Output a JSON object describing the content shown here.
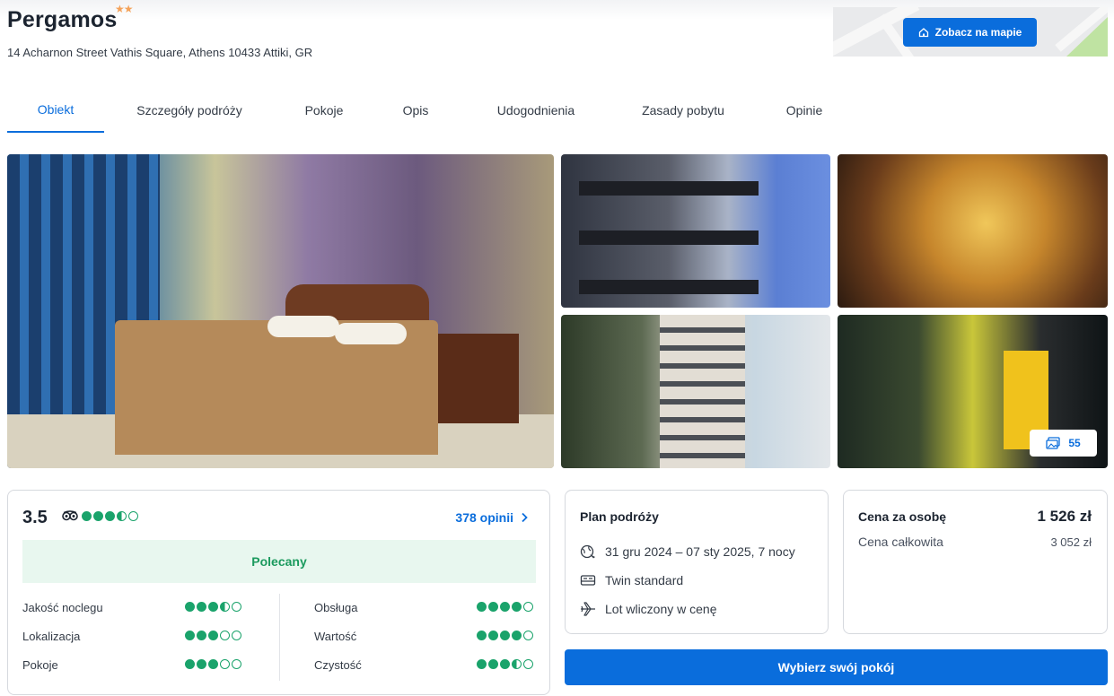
{
  "hotel": {
    "name": "Pergamos",
    "stars": "★★",
    "address": "14 Acharnon Street Vathis Square, Athens 10433 Attiki, GR"
  },
  "map": {
    "button_label": "Zobacz na mapie",
    "icon": "home-icon"
  },
  "tabs": [
    {
      "label": "Obiekt",
      "active": true
    },
    {
      "label": "Szczegóły podróży",
      "active": false
    },
    {
      "label": "Pokoje",
      "active": false
    },
    {
      "label": "Opis",
      "active": false
    },
    {
      "label": "Udogodnienia",
      "active": false
    },
    {
      "label": "Zasady pobytu",
      "active": false
    },
    {
      "label": "Opinie",
      "active": false
    }
  ],
  "gallery": {
    "photo_count": "55",
    "icon": "images-icon"
  },
  "rating": {
    "score": "3.5",
    "overall": 3.5,
    "reviews_link": "378 opinii",
    "badge": "Polecany",
    "categories": [
      {
        "label": "Jakość noclegu",
        "value": 3.5
      },
      {
        "label": "Lokalizacja",
        "value": 3
      },
      {
        "label": "Pokoje",
        "value": 3
      },
      {
        "label": "Obsługa",
        "value": 4
      },
      {
        "label": "Wartość",
        "value": 4
      },
      {
        "label": "Czystość",
        "value": 3.5
      }
    ]
  },
  "plan": {
    "title": "Plan podróży",
    "dates": "31 gru 2024 – 07 sty 2025, 7 nocy",
    "room": "Twin standard",
    "flight": "Lot wliczony w cenę"
  },
  "price": {
    "per_person_label": "Cena za osobę",
    "per_person_value": "1 526 zł",
    "total_label": "Cena całkowita",
    "total_value": "3 052 zł"
  },
  "cta": {
    "label": "Wybierz swój pokój"
  },
  "colors": {
    "accent": "#0a6ddc",
    "rating_green": "#1aa36b",
    "badge_bg": "#e8f7ef",
    "star": "#f4a259"
  }
}
